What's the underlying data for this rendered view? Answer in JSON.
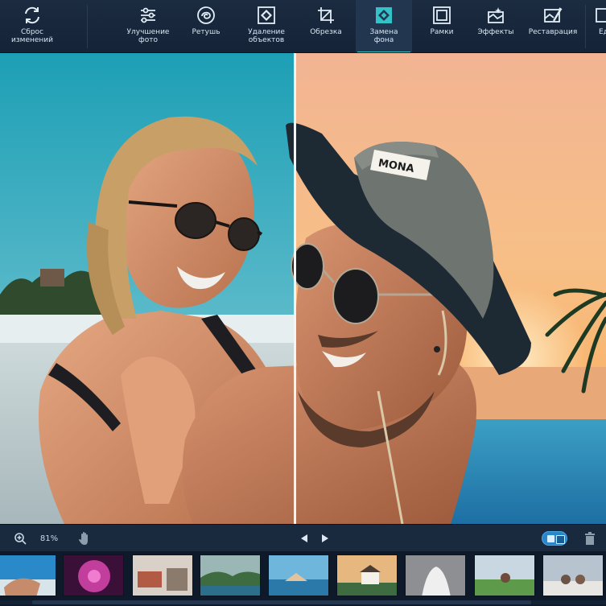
{
  "toolbar": {
    "items": [
      {
        "name": "reset",
        "label": "Сброс\nизменений",
        "icon": "reset-icon"
      },
      {
        "name": "enhance",
        "label": "Улучшение\nфото",
        "icon": "sliders-icon"
      },
      {
        "name": "retouch",
        "label": "Ретушь",
        "icon": "retouch-icon"
      },
      {
        "name": "remove-objects",
        "label": "Удаление\nобъектов",
        "icon": "remove-objects-icon"
      },
      {
        "name": "crop",
        "label": "Обрезка",
        "icon": "crop-icon"
      },
      {
        "name": "replace-bg",
        "label": "Замена\nфона",
        "icon": "replace-background-icon",
        "active": true
      },
      {
        "name": "frames",
        "label": "Рамки",
        "icon": "frame-icon"
      },
      {
        "name": "effects",
        "label": "Эффекты",
        "icon": "effects-icon"
      },
      {
        "name": "restore",
        "label": "Реставрация",
        "icon": "restore-icon"
      },
      {
        "name": "more",
        "label": "Ед",
        "icon": "more-icon"
      }
    ]
  },
  "hat_text": "MONA",
  "navbar": {
    "zoom_value": "81%",
    "icons": [
      "zoom-in-icon",
      "hand-icon",
      "prev-arrow-icon",
      "next-arrow-icon",
      "before-after-toggle",
      "trash-icon"
    ]
  },
  "colors": {
    "accent": "#33c2c7",
    "toolbar_bg": "#1b2b40",
    "toggle": "#2a86c8"
  }
}
